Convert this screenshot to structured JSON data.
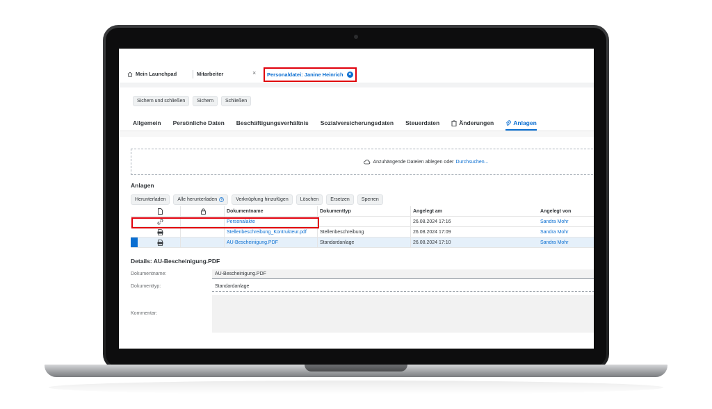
{
  "shell": {
    "tabs": [
      {
        "label": "Mein Launchpad",
        "icon": "home-icon"
      },
      {
        "label": "Mitarbeiter"
      },
      {
        "label": "Personaldatei: Janine Heinrich",
        "active": true
      }
    ],
    "close_glyph": "×",
    "active_close_glyph": "×"
  },
  "toolbar": {
    "save_close": "Sichern und schließen",
    "save": "Sichern",
    "close": "Schließen"
  },
  "object_tabs": [
    {
      "label": "Allgemein"
    },
    {
      "label": "Persönliche Daten"
    },
    {
      "label": "Beschäftigungsverhältnis"
    },
    {
      "label": "Sozialversicherungsdaten"
    },
    {
      "label": "Steuerdaten"
    },
    {
      "label": "Änderungen",
      "icon": "clipboard-icon"
    },
    {
      "label": "Anlagen",
      "icon": "paperclip-icon",
      "selected": true
    }
  ],
  "dropzone": {
    "text": "Anzuhängende Dateien ablegen oder",
    "link": "Durchsuchen..."
  },
  "attachments": {
    "title": "Anlagen",
    "toolbar": {
      "download": "Herunterladen",
      "download_all": "Alle herunterladen",
      "add_link": "Verknüpfung hinzufügen",
      "delete": "Löschen",
      "replace": "Ersetzen",
      "lock": "Sperren"
    },
    "columns": {
      "doc_icon": "document-icon",
      "lock_icon": "lock-icon",
      "name": "Dokumentname",
      "type": "Dokumenttyp",
      "created_at": "Angelegt am",
      "created_by": "Angelegt von"
    },
    "rows": [
      {
        "icon": "link-icon",
        "name": "Personalakte",
        "type": "",
        "created_at": "26.08.2024 17:16",
        "created_by": "Sandra Mohr"
      },
      {
        "icon": "pdf-icon",
        "name": "Stellenbeschreibung_Kontrukteur.pdf",
        "type": "Stellenbeschreibung",
        "created_at": "26.08.2024 17:09",
        "created_by": "Sandra Mohr"
      },
      {
        "icon": "pdf-icon",
        "name": "AU-Bescheinigung.PDF",
        "type": "Standardanlage",
        "created_at": "26.08.2024 17:10",
        "created_by": "Sandra Mohr",
        "selected": true
      }
    ]
  },
  "details": {
    "title": "Details: AU-Bescheinigung.PDF",
    "name_label": "Dokumentname:",
    "name_value": "AU-Bescheinigung.PDF",
    "type_label": "Dokumenttyp:",
    "type_value": "Standardanlage",
    "comment_label": "Kommentar:",
    "comment_value": ""
  },
  "colors": {
    "accent": "#0a6ed1",
    "highlight_box": "#e0000c",
    "selected_row": "#e5f0fa"
  }
}
